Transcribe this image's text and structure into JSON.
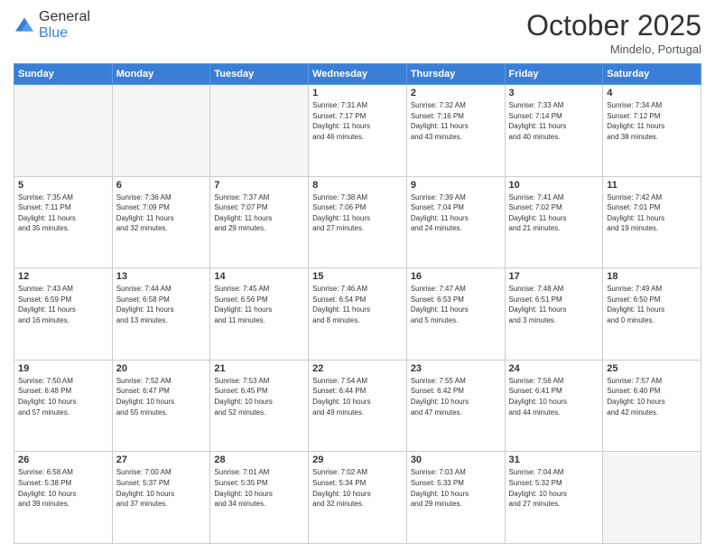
{
  "header": {
    "logo_general": "General",
    "logo_blue": "Blue",
    "month": "October 2025",
    "location": "Mindelo, Portugal"
  },
  "weekdays": [
    "Sunday",
    "Monday",
    "Tuesday",
    "Wednesday",
    "Thursday",
    "Friday",
    "Saturday"
  ],
  "weeks": [
    [
      {
        "day": "",
        "info": ""
      },
      {
        "day": "",
        "info": ""
      },
      {
        "day": "",
        "info": ""
      },
      {
        "day": "1",
        "info": "Sunrise: 7:31 AM\nSunset: 7:17 PM\nDaylight: 11 hours\nand 46 minutes."
      },
      {
        "day": "2",
        "info": "Sunrise: 7:32 AM\nSunset: 7:16 PM\nDaylight: 11 hours\nand 43 minutes."
      },
      {
        "day": "3",
        "info": "Sunrise: 7:33 AM\nSunset: 7:14 PM\nDaylight: 11 hours\nand 40 minutes."
      },
      {
        "day": "4",
        "info": "Sunrise: 7:34 AM\nSunset: 7:12 PM\nDaylight: 11 hours\nand 38 minutes."
      }
    ],
    [
      {
        "day": "5",
        "info": "Sunrise: 7:35 AM\nSunset: 7:11 PM\nDaylight: 11 hours\nand 35 minutes."
      },
      {
        "day": "6",
        "info": "Sunrise: 7:36 AM\nSunset: 7:09 PM\nDaylight: 11 hours\nand 32 minutes."
      },
      {
        "day": "7",
        "info": "Sunrise: 7:37 AM\nSunset: 7:07 PM\nDaylight: 11 hours\nand 29 minutes."
      },
      {
        "day": "8",
        "info": "Sunrise: 7:38 AM\nSunset: 7:06 PM\nDaylight: 11 hours\nand 27 minutes."
      },
      {
        "day": "9",
        "info": "Sunrise: 7:39 AM\nSunset: 7:04 PM\nDaylight: 11 hours\nand 24 minutes."
      },
      {
        "day": "10",
        "info": "Sunrise: 7:41 AM\nSunset: 7:02 PM\nDaylight: 11 hours\nand 21 minutes."
      },
      {
        "day": "11",
        "info": "Sunrise: 7:42 AM\nSunset: 7:01 PM\nDaylight: 11 hours\nand 19 minutes."
      }
    ],
    [
      {
        "day": "12",
        "info": "Sunrise: 7:43 AM\nSunset: 6:59 PM\nDaylight: 11 hours\nand 16 minutes."
      },
      {
        "day": "13",
        "info": "Sunrise: 7:44 AM\nSunset: 6:58 PM\nDaylight: 11 hours\nand 13 minutes."
      },
      {
        "day": "14",
        "info": "Sunrise: 7:45 AM\nSunset: 6:56 PM\nDaylight: 11 hours\nand 11 minutes."
      },
      {
        "day": "15",
        "info": "Sunrise: 7:46 AM\nSunset: 6:54 PM\nDaylight: 11 hours\nand 8 minutes."
      },
      {
        "day": "16",
        "info": "Sunrise: 7:47 AM\nSunset: 6:53 PM\nDaylight: 11 hours\nand 5 minutes."
      },
      {
        "day": "17",
        "info": "Sunrise: 7:48 AM\nSunset: 6:51 PM\nDaylight: 11 hours\nand 3 minutes."
      },
      {
        "day": "18",
        "info": "Sunrise: 7:49 AM\nSunset: 6:50 PM\nDaylight: 11 hours\nand 0 minutes."
      }
    ],
    [
      {
        "day": "19",
        "info": "Sunrise: 7:50 AM\nSunset: 6:48 PM\nDaylight: 10 hours\nand 57 minutes."
      },
      {
        "day": "20",
        "info": "Sunrise: 7:52 AM\nSunset: 6:47 PM\nDaylight: 10 hours\nand 55 minutes."
      },
      {
        "day": "21",
        "info": "Sunrise: 7:53 AM\nSunset: 6:45 PM\nDaylight: 10 hours\nand 52 minutes."
      },
      {
        "day": "22",
        "info": "Sunrise: 7:54 AM\nSunset: 6:44 PM\nDaylight: 10 hours\nand 49 minutes."
      },
      {
        "day": "23",
        "info": "Sunrise: 7:55 AM\nSunset: 6:42 PM\nDaylight: 10 hours\nand 47 minutes."
      },
      {
        "day": "24",
        "info": "Sunrise: 7:56 AM\nSunset: 6:41 PM\nDaylight: 10 hours\nand 44 minutes."
      },
      {
        "day": "25",
        "info": "Sunrise: 7:57 AM\nSunset: 6:40 PM\nDaylight: 10 hours\nand 42 minutes."
      }
    ],
    [
      {
        "day": "26",
        "info": "Sunrise: 6:58 AM\nSunset: 5:38 PM\nDaylight: 10 hours\nand 39 minutes."
      },
      {
        "day": "27",
        "info": "Sunrise: 7:00 AM\nSunset: 5:37 PM\nDaylight: 10 hours\nand 37 minutes."
      },
      {
        "day": "28",
        "info": "Sunrise: 7:01 AM\nSunset: 5:35 PM\nDaylight: 10 hours\nand 34 minutes."
      },
      {
        "day": "29",
        "info": "Sunrise: 7:02 AM\nSunset: 5:34 PM\nDaylight: 10 hours\nand 32 minutes."
      },
      {
        "day": "30",
        "info": "Sunrise: 7:03 AM\nSunset: 5:33 PM\nDaylight: 10 hours\nand 29 minutes."
      },
      {
        "day": "31",
        "info": "Sunrise: 7:04 AM\nSunset: 5:32 PM\nDaylight: 10 hours\nand 27 minutes."
      },
      {
        "day": "",
        "info": ""
      }
    ]
  ]
}
